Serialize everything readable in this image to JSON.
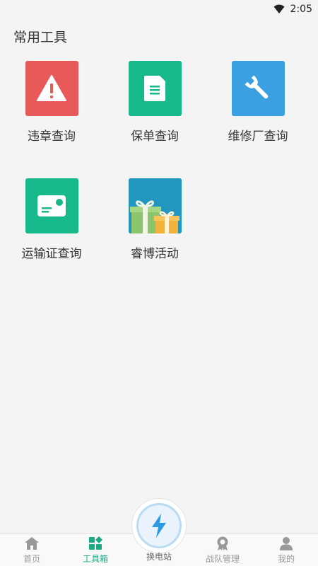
{
  "status_bar": {
    "time": "2:05",
    "wifi_icon": "wifi-icon"
  },
  "section": {
    "title": "常用工具"
  },
  "tools": [
    {
      "label": "违章查询",
      "icon": "warning-icon",
      "color": "#e85a5a"
    },
    {
      "label": "保单查询",
      "icon": "document-icon",
      "color": "#17b88a"
    },
    {
      "label": "维修厂查询",
      "icon": "wrench-icon",
      "color": "#3ba0e2"
    },
    {
      "label": "运输证查询",
      "icon": "card-icon",
      "color": "#17b88a"
    },
    {
      "label": "睿博活动",
      "icon": "gift-icon",
      "color": "#2396bf"
    }
  ],
  "bottom_nav": {
    "items": [
      {
        "label": "首页",
        "icon": "home-icon"
      },
      {
        "label": "工具箱",
        "icon": "toolbox-icon",
        "active": true
      },
      {
        "label": "战队管理",
        "icon": "badge-icon"
      },
      {
        "label": "我的",
        "icon": "user-icon"
      }
    ],
    "center": {
      "label": "换电站",
      "icon": "lightning-icon"
    }
  },
  "colors": {
    "accent": "#1aaa86",
    "inactive": "#999999"
  }
}
